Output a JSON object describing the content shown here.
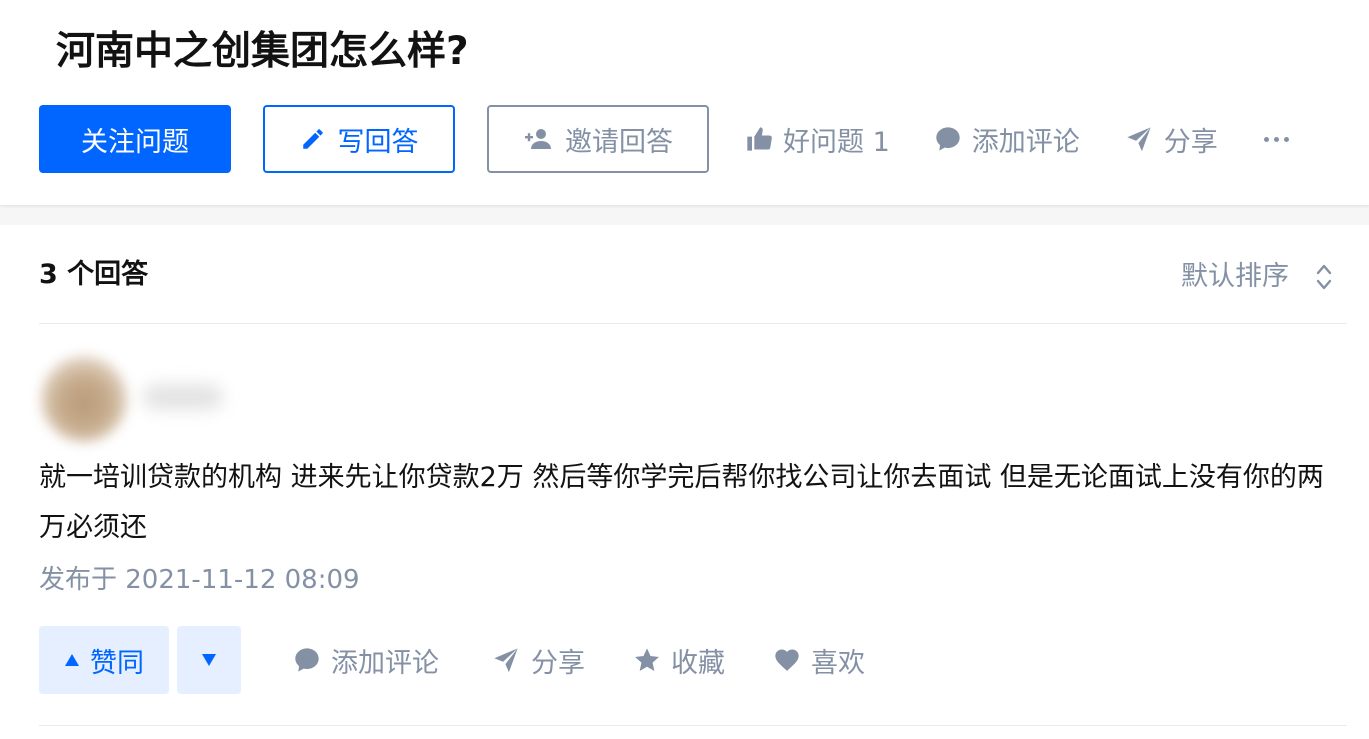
{
  "question": {
    "title": "河南中之创集团怎么样?",
    "follow_label": "关注问题",
    "write_label": "写回答",
    "invite_label": "邀请回答",
    "good_question_label": "好问题 1",
    "comment_label": "添加评论",
    "share_label": "分享"
  },
  "answers": {
    "count_label": "3 个回答",
    "sort_label": "默认排序",
    "items": [
      {
        "content": "就一培训贷款的机构 进来先让你贷款2万 然后等你学完后帮你找公司让你去面试 但是无论面试上没有你的两万必须还",
        "publish_time": "发布于 2021-11-12 08:09",
        "upvote_label": "赞同",
        "comment_label": "添加评论",
        "share_label": "分享",
        "favorite_label": "收藏",
        "like_label": "喜欢"
      }
    ]
  },
  "colors": {
    "primary": "#0066ff",
    "muted": "#8491a5",
    "text": "#121212",
    "upvote_bg": "#e5efff"
  },
  "icons": [
    "pencil-icon",
    "add-user-icon",
    "thumbs-up-icon",
    "comment-icon",
    "share-icon",
    "more-icon",
    "sort-icon",
    "triangle-up-icon",
    "triangle-down-icon",
    "star-icon",
    "heart-icon"
  ]
}
